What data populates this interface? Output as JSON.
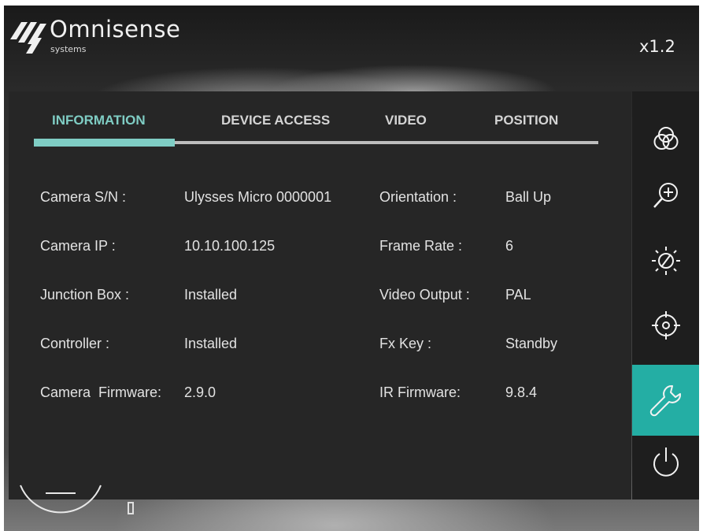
{
  "brand": {
    "name": "Omnisense",
    "sub": "systems"
  },
  "zoom_label": "x1.2",
  "tabs": [
    {
      "label": "INFORMATION",
      "active": true
    },
    {
      "label": "DEVICE ACCESS",
      "active": false
    },
    {
      "label": "VIDEO",
      "active": false
    },
    {
      "label": "POSITION",
      "active": false
    }
  ],
  "info_left": [
    {
      "label": "Camera S/N :",
      "value": "Ulysses Micro 0000001"
    },
    {
      "label": "Camera IP :",
      "value": "10.10.100.125"
    },
    {
      "label": "Junction Box :",
      "value": "Installed"
    },
    {
      "label": "Controller :",
      "value": "Installed"
    },
    {
      "label": "Camera  Firmware:",
      "value": "2.9.0"
    }
  ],
  "info_right": [
    {
      "label": "Orientation :",
      "value": "Ball Up"
    },
    {
      "label": "Frame Rate :",
      "value": "6"
    },
    {
      "label": "Video Output :",
      "value": "PAL"
    },
    {
      "label": "Fx Key :",
      "value": "Standby"
    },
    {
      "label": "IR Firmware:",
      "value": "9.8.4"
    }
  ],
  "sidebar": [
    {
      "icon": "color-circles-icon",
      "active": false
    },
    {
      "icon": "zoom-in-icon",
      "active": false
    },
    {
      "icon": "brightness-icon",
      "active": false
    },
    {
      "icon": "target-icon",
      "active": false
    },
    {
      "icon": "wrench-icon",
      "active": true
    },
    {
      "icon": "power-icon",
      "active": false
    }
  ],
  "colors": {
    "accent": "#7fcdc4",
    "active_sidebar": "#24aea4",
    "panel": "#262626",
    "text": "#e2e2e2"
  }
}
